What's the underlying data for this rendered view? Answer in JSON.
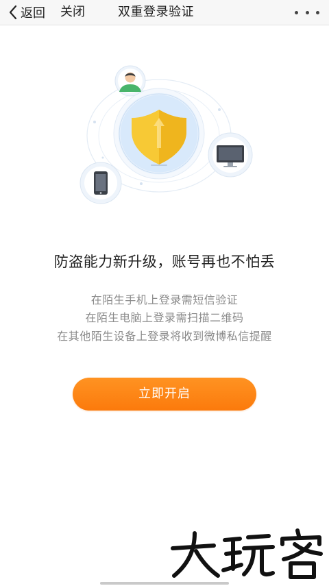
{
  "header": {
    "back_label": "返回",
    "close_label": "关闭",
    "title": "双重登录验证",
    "more_icon": "more-dots-icon"
  },
  "illustration": {
    "icons": [
      "user-avatar-icon",
      "shield-icon",
      "monitor-icon",
      "phone-icon"
    ],
    "colors": {
      "ring": "#dfeaf7",
      "circle_fill": "#d6e8fb",
      "shield": "#f7c935",
      "shield_dark": "#e9ad17",
      "avatar_shirt": "#49b46a"
    }
  },
  "main": {
    "headline": "防盗能力新升级，账号再也不怕丢",
    "descriptions": [
      "在陌生手机上登录需短信验证",
      "在陌生电脑上登录需扫描二维码",
      "在其他陌生设备上登录将收到微博私信提醒"
    ],
    "enable_button": "立即开启"
  },
  "watermark": {
    "text": "大玩客"
  },
  "colors": {
    "accent": "#fb7a0c",
    "text_primary": "#1f1f1f",
    "text_secondary": "#8a8a8a"
  }
}
